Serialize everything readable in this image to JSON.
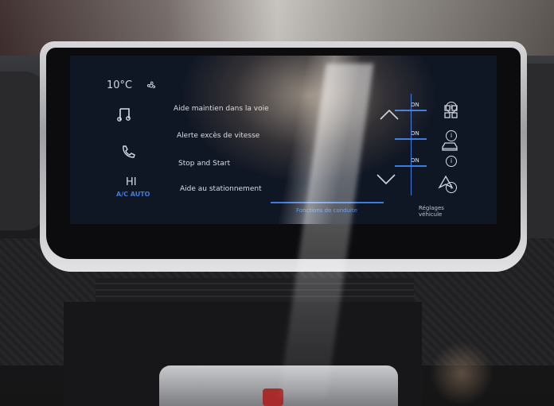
{
  "screen": {
    "temperature": "10°C",
    "fan_level": "HI",
    "ac_mode": "A/C  AUTO",
    "settings": [
      {
        "label": "Aide maintien dans la voie",
        "state": "ON"
      },
      {
        "label": "Alerte excès de vitesse",
        "state": "ON"
      },
      {
        "label": "Stop and Start",
        "state": "ON"
      },
      {
        "label": "Aide au stationnement",
        "state": ""
      }
    ],
    "tabs": {
      "active": "Fonctions de conduite",
      "other": "Réglages véhicule"
    },
    "info_glyph": "i"
  },
  "colors": {
    "accent": "#3d7be0",
    "screen_bg": "#101724",
    "text": "#d9dfe9"
  }
}
